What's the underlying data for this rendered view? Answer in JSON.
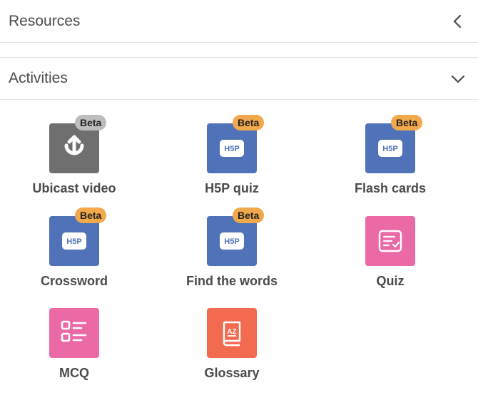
{
  "sections": {
    "resources": {
      "title": "Resources",
      "state": "collapsed",
      "icon": "chevron-left-icon"
    },
    "activities": {
      "title": "Activities",
      "state": "expanded",
      "icon": "chevron-down-icon"
    }
  },
  "activities": [
    {
      "label": "Ubicast video",
      "icon": "ubicast-icon",
      "color": "#6f6f6f",
      "badge": "Beta",
      "badge_color": "#bdbdbd"
    },
    {
      "label": "H5P quiz",
      "icon": "h5p-icon",
      "color": "#4f72b8",
      "badge": "Beta",
      "badge_color": "#f1a94b"
    },
    {
      "label": "Flash cards",
      "icon": "h5p-icon",
      "color": "#4f72b8",
      "badge": "Beta",
      "badge_color": "#f1a94b"
    },
    {
      "label": "Crossword",
      "icon": "h5p-icon",
      "color": "#4f72b8",
      "badge": "Beta",
      "badge_color": "#f1a94b"
    },
    {
      "label": "Find the words",
      "icon": "h5p-icon",
      "color": "#4f72b8",
      "badge": "Beta",
      "badge_color": "#f1a94b"
    },
    {
      "label": "Quiz",
      "icon": "quiz-checklist-icon",
      "color": "#eb6aa6"
    },
    {
      "label": "MCQ",
      "icon": "mcq-list-icon",
      "color": "#eb6aa6"
    },
    {
      "label": "Glossary",
      "icon": "glossary-book-icon",
      "color": "#f26b50"
    }
  ]
}
